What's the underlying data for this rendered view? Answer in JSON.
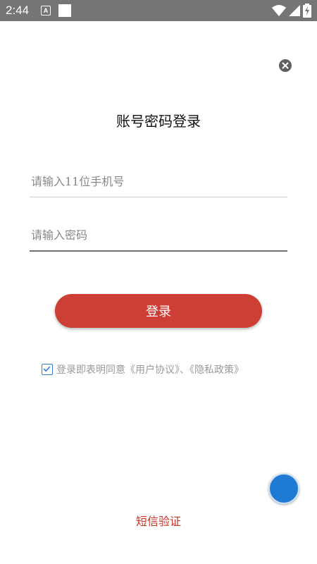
{
  "status_bar": {
    "time": "2:44",
    "notification_letter": "A",
    "icons": [
      "notification-a-icon",
      "notification-square-icon",
      "wifi-icon",
      "signal-icon",
      "battery-charging-icon"
    ]
  },
  "login": {
    "title": "账号密码登录",
    "phone_placeholder": "请输入11位手机号",
    "password_placeholder": "请输入密码",
    "login_button": "登录",
    "agreement_prefix": "登录即表明同意",
    "user_agreement": "《用户协议》",
    "separator": "、",
    "privacy_policy": "《隐私政策》",
    "agreement_checked": true,
    "sms_link": "短信验证"
  },
  "colors": {
    "status_bar": "#757575",
    "primary_button": "#cd3e34",
    "link_red": "#c8352b",
    "checkbox_blue": "#2f7fd8",
    "fab_blue": "#1f7ad3"
  }
}
